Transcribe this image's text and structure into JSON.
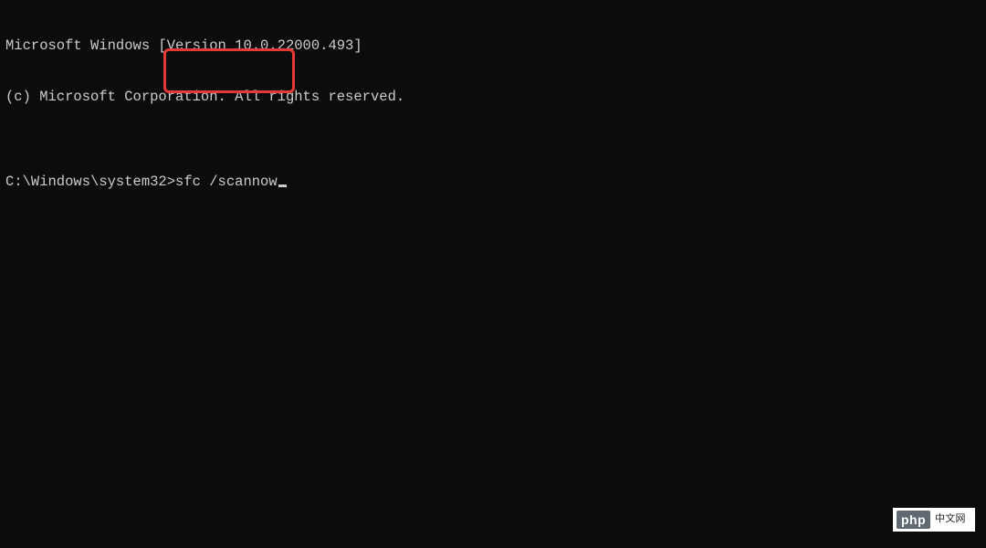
{
  "terminal": {
    "header_line1": "Microsoft Windows [Version 10.0.22000.493]",
    "header_line2": "(c) Microsoft Corporation. All rights reserved.",
    "blank": "",
    "prompt": "C:\\Windows\\system32>",
    "command": "sfc /scannow"
  },
  "watermark": {
    "php": "php",
    "cn": "中文网"
  }
}
